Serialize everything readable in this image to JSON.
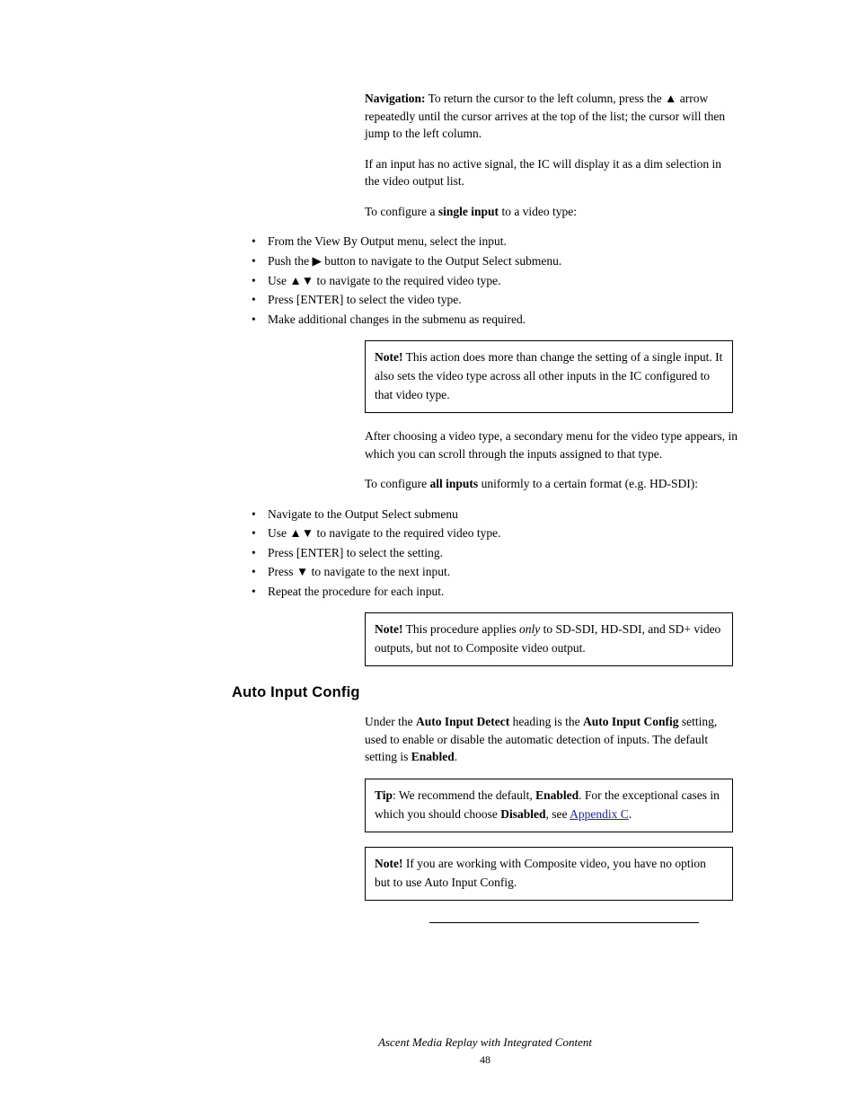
{
  "section": {
    "label": "Navigation:",
    "text": " To return the cursor to the left column, press the ▲ arrow repeatedly until the cursor arrives at the top of the list; the cursor will then jump to the left column."
  },
  "subparas": {
    "p1": "If an input has no active signal, the IC will display it as a dim selection in the video output list.",
    "p2_a": "To configure a ",
    "p2_b": "single input",
    "p2_c": " to a video type:"
  },
  "bullets1": [
    "From the View By Output menu, select the input.",
    "Push the ▶ button to navigate to the Output Select submenu.",
    "Use ▲▼ to navigate to the required video type.",
    "Press [ENTER] to select the video type.",
    "Make additional changes in the submenu as required."
  ],
  "note1": {
    "label": "Note!",
    "text": " This action does more than change the setting of a single input. It also sets the video type across all other inputs in the IC configured to that video type."
  },
  "post_note1": "After choosing a video type, a secondary menu for the video type appears, in which you can scroll through the inputs assigned to that type.",
  "p3_a": "To configure ",
  "p3_b": "all inputs",
  "p3_c": " uniformly to a certain format (e.g. HD-SDI):",
  "bullets2": [
    "Navigate to the Output Select submenu",
    "Use ▲▼ to navigate to the required video type.",
    "Press [ENTER] to select the setting.",
    "Press ▼ to navigate to the next input.",
    "Repeat the procedure for each input."
  ],
  "note2": {
    "label": "Note!",
    "text1": " This procedure applies ",
    "text2": "only",
    "text3": " to SD-SDI, HD-SDI, and SD+ video outputs, but not to Composite video output."
  },
  "subheading": "Auto Input Config",
  "auto_para1_a": "Under the ",
  "auto_para1_b": "Auto Input Detect",
  "auto_para1_c": " heading is the ",
  "auto_para1_d": "Auto Input Config ",
  "auto_para1_e": "setting, used to enable or disable the automatic detection of inputs. The default setting is ",
  "auto_para1_f": "Enabled",
  "auto_para1_g": ".",
  "note3": {
    "label": "Tip",
    "text1": ": We recommend the default, ",
    "text2": "Enabled",
    "text3": ". For the exceptional cases in which you should choose ",
    "text4": "Disabled",
    "text5": ", see ",
    "link": "Appendix C",
    "text6": "."
  },
  "note4": {
    "label": "Note!",
    "text": " If you are working with Composite video, you have no option but to use Auto Input Config."
  },
  "footer": {
    "title": "Ascent Media Replay with Integrated Content",
    "page": "48"
  }
}
